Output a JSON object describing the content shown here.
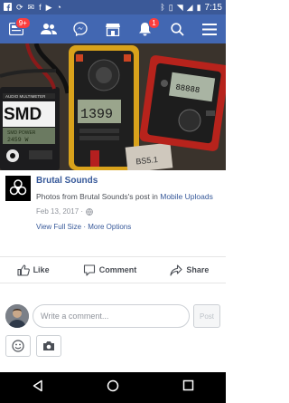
{
  "status_bar": {
    "time": "7:15",
    "notification_count": "9+"
  },
  "nav": {
    "notifications_badge": "1"
  },
  "post": {
    "page_name": "Brutal Sounds",
    "description_prefix": "Photos from Brutal Sounds's post in ",
    "album_link": "Mobile Uploads",
    "date": "Feb 13, 2017 · ",
    "view_full_size": "View Full Size",
    "separator": " · ",
    "more_options": "More Options"
  },
  "photo_text": {
    "multimeter_label": "AUDIO MULTIMETER",
    "brand": "SMD",
    "brand_sub": "SMD POWER",
    "reading": "2459 W",
    "meter_reading": "1399",
    "clamp_text": "BS5.1",
    "clamp_reading": "88888"
  },
  "actions": {
    "like": "Like",
    "comment": "Comment",
    "share": "Share"
  },
  "comment_box": {
    "placeholder": "Write a comment...",
    "post_label": "Post"
  },
  "colors": {
    "facebook_blue": "#4267b2",
    "status_blue": "#3b5998",
    "link_blue": "#365899"
  }
}
